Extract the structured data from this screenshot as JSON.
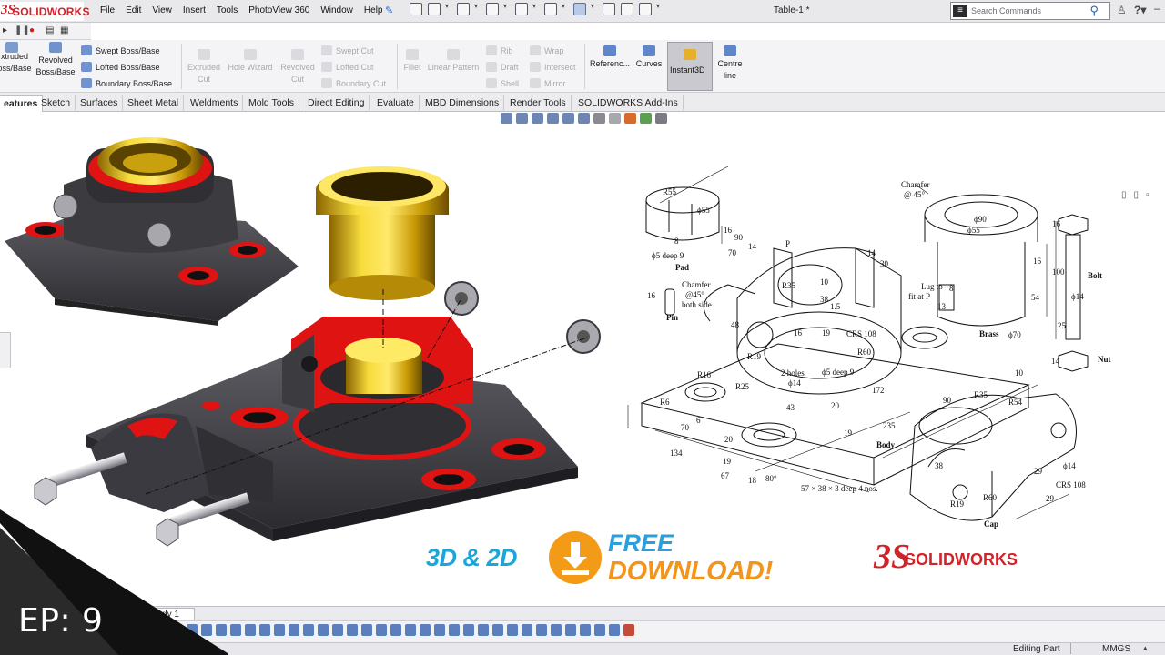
{
  "app": {
    "brand_ds": "3S",
    "brand_word": "SOLIDWORKS",
    "document_title": "Table-1 *"
  },
  "menu": [
    "File",
    "Edit",
    "View",
    "Insert",
    "Tools",
    "PhotoView 360",
    "Window",
    "Help"
  ],
  "search": {
    "placeholder": "Search Commands"
  },
  "commands": {
    "extruded": [
      "xtruded",
      "oss/Base"
    ],
    "revolved": [
      "Revolved",
      "Boss/Base"
    ],
    "swept_boss": "Swept Boss/Base",
    "lofted_boss": "Lofted Boss/Base",
    "boundary_boss": "Boundary Boss/Base",
    "extruded_cut": [
      "Extruded",
      "Cut"
    ],
    "hole_wizard": "Hole Wizard",
    "revolved_cut": [
      "Revolved",
      "Cut"
    ],
    "swept_cut": "Swept Cut",
    "lofted_cut": "Lofted Cut",
    "boundary_cut": "Boundary Cut",
    "fillet": "Fillet",
    "linear_pattern": "Linear Pattern",
    "rib": "Rib",
    "draft": "Draft",
    "shell": "Shell",
    "wrap": "Wrap",
    "intersect": "Intersect",
    "mirror": "Mirror",
    "reference": "Referenc...",
    "curves": "Curves",
    "instant3d": "Instant3D",
    "centre_line": [
      "Centre",
      "line"
    ]
  },
  "tabs": [
    "eatures",
    "Sketch",
    "Surfaces",
    "Sheet Metal",
    "Weldments",
    "Mold Tools",
    "Direct Editing",
    "Evaluate",
    "MBD Dimensions",
    "Render Tools",
    "SOLIDWORKS Add-Ins"
  ],
  "drawing_labels": {
    "pad": "Pad",
    "pin": "Pin",
    "body": "Body",
    "cap": "Cap",
    "brass": "Brass",
    "bolt": "Bolt",
    "nut": "Nut",
    "r55": "R55",
    "d55_pad": "ϕ55",
    "pad_16": "16",
    "pad_8": "8",
    "pad_hole": "ϕ5 deep 9",
    "chamfer_pin": "Chamfer",
    "chamfer_pin_angle": "@45°",
    "both_side": "both side",
    "pin_16": "16",
    "chamfer_top": "Chamfer",
    "chamfer_top_angle": "@ 45°",
    "d90": "ϕ90",
    "d55_brass": "ϕ55",
    "brass_16": "16",
    "brass_54": "54",
    "brass_d70": "ϕ70",
    "brass_13": "13",
    "brass_8": "8",
    "lug_1": "Lug to",
    "lug_2": "fit at P",
    "bolt_100": "100",
    "bolt_d14": "ϕ14",
    "bolt_25": "25",
    "bolt_16": "16",
    "nut_14": "14",
    "b90": "90",
    "b14": "14",
    "b70": "70",
    "b48": "48",
    "b30": "30",
    "b14b": "14",
    "r35": "R35",
    "b10": "10",
    "b38": "38",
    "b15": "1.5",
    "crs108": "CRS 108",
    "r60": "R60",
    "r19": "R19",
    "b16": "16",
    "b19": "19",
    "holes": "2 holes",
    "d14": "ϕ14",
    "d5deep": "ϕ5 deep 9",
    "b20": "20",
    "b43": "43",
    "b172": "172",
    "b235": "235",
    "r16": "R16",
    "r6": "R6",
    "r25": "R25",
    "b6": "6",
    "b70b": "70",
    "b134": "134",
    "b19b": "19",
    "b67": "67",
    "b18": "18",
    "deg80": "80°",
    "b20b": "20",
    "b19c": "19",
    "slot_note": "57 × 38 × 3 deep 4 nos.",
    "b10b": "10",
    "c90": "90",
    "c_r35": "R35",
    "c_r54": "R54",
    "c_d14": "ϕ14",
    "c38": "38",
    "c29": "29",
    "c_crs108": "CRS 108",
    "c29b": "29",
    "c_r19": "R19",
    "c_r60": "R60",
    "p": "P"
  },
  "banner": {
    "tag_3d2d": "3D & 2D",
    "free": "FREE",
    "download": "DOWNLOAD!",
    "logo_ds": "3S",
    "logo_word": "SOLIDWORKS"
  },
  "bottom": {
    "study_tab": "Study 1",
    "status_mode": "Editing Part",
    "status_units": "MMGS",
    "episode": "EP: 9"
  },
  "colors": {
    "brand_red": "#d0232a",
    "section_red": "#e01313",
    "body_dark": "#3a3a3e",
    "brass_gold": "#e8c11a",
    "banner_blue": "#1aa6d8",
    "banner_orange": "#f39a17"
  }
}
